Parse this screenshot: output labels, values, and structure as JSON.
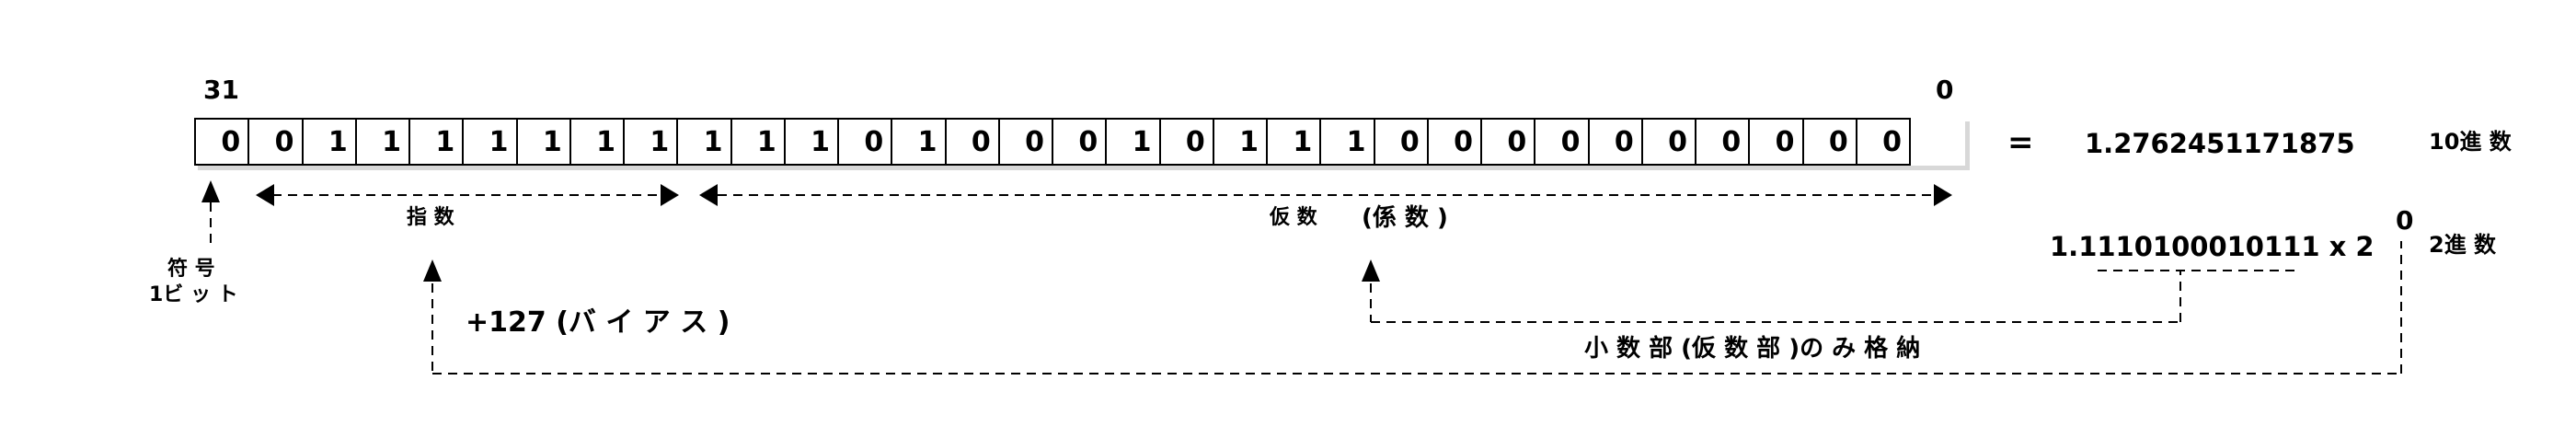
{
  "bit_high_index": "31",
  "bit_low_index": "0",
  "bits": [
    "0",
    "0",
    "1",
    "1",
    "1",
    "1",
    "1",
    "1",
    "1",
    "1",
    "1",
    "1",
    "0",
    "1",
    "0",
    "0",
    "0",
    "1",
    "0",
    "1",
    "1",
    "1",
    "0",
    "0",
    "0",
    "0",
    "0",
    "0",
    "0",
    "0",
    "0",
    "0"
  ],
  "equals": "=",
  "decimal_value": "1.2762451171875",
  "decimal_base_label": "10進 数",
  "exponent_label": "指 数",
  "mantissa_label": "仮 数",
  "coefficient_label": "(係 数 )",
  "binary_value": "1.1110100010111 x 2",
  "binary_exponent": "0",
  "binary_base_label": "2進 数",
  "sign_label_line1": "符 号",
  "sign_label_line2": "1ビ ッ ト",
  "bias_label": "+127 (バ イ ア ス )",
  "fraction_note": "小 数 部 (仮 数 部 )の み 格 納"
}
